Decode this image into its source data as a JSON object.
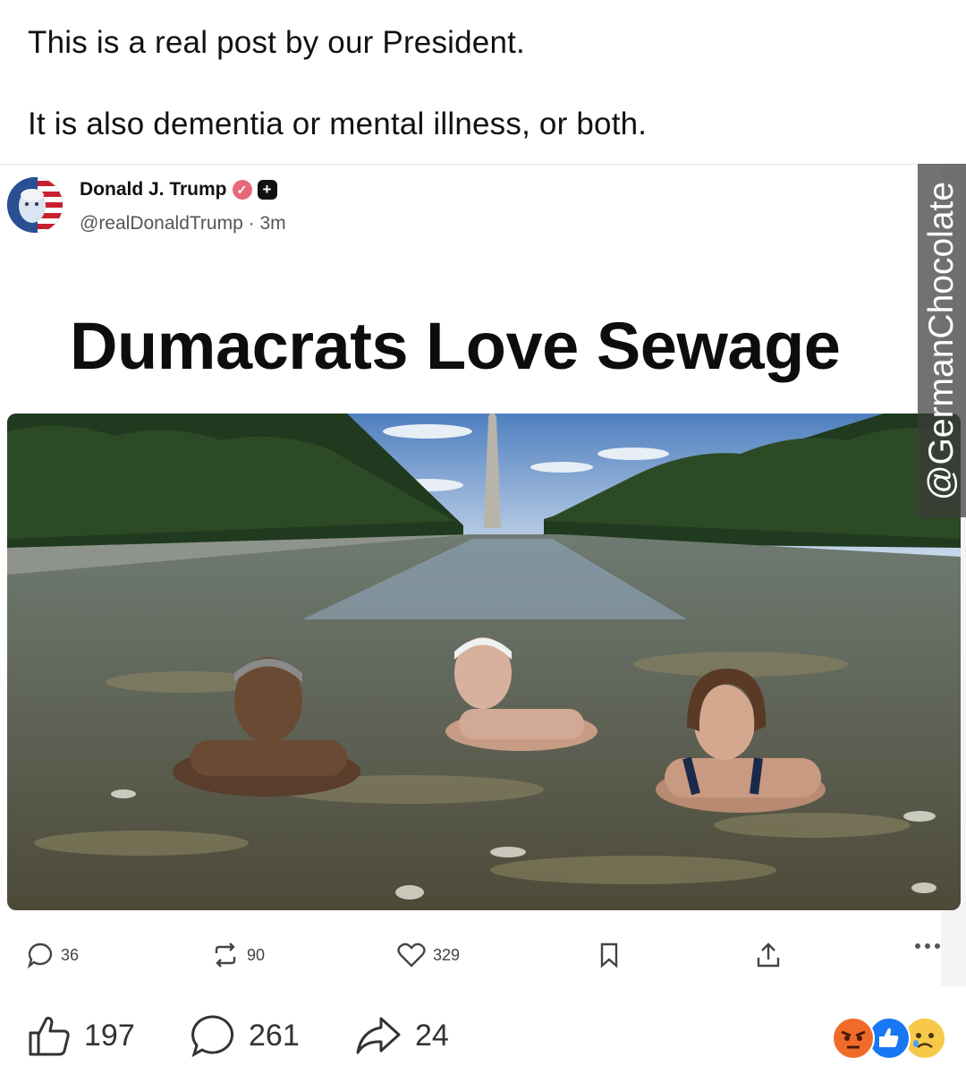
{
  "caption": {
    "line1": "This is a real post by our President.",
    "line2": "It is also dementia or mental illness, or both."
  },
  "post": {
    "author": "Donald J. Trump",
    "handle": "@realDonaldTrump · 3m",
    "headline": "Dumacrats Love Sewage",
    "actions": {
      "replies": "36",
      "reposts": "90",
      "likes": "329"
    }
  },
  "watermark": "@GermanChocolate",
  "facebook": {
    "likes": "197",
    "comments": "261",
    "shares": "24",
    "reactions": [
      "angry-reaction-icon",
      "like-reaction-icon",
      "sad-reaction-icon"
    ]
  },
  "colors": {
    "verified": "#e46a7a",
    "like_blue": "#1877f2",
    "angry": "#f06b2a",
    "sad": "#f7c948"
  }
}
